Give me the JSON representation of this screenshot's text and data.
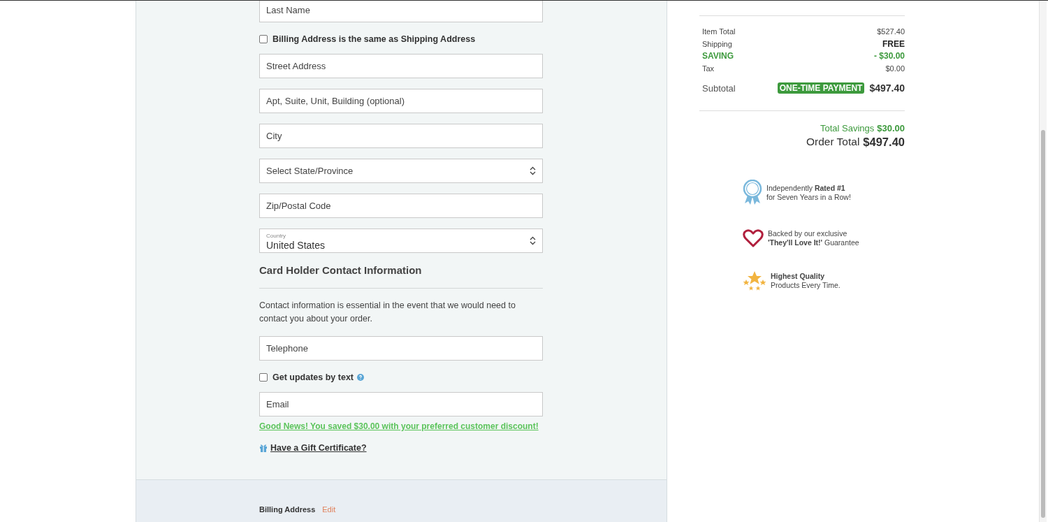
{
  "form": {
    "fields_top": [
      {
        "placeholder": "Last Name"
      }
    ],
    "same_address": {
      "label": "Billing Address is the same as Shipping Address",
      "checked": false
    },
    "address_fields": [
      {
        "kind": "text",
        "placeholder": "Street Address"
      },
      {
        "kind": "text",
        "placeholder": "Apt, Suite, Unit, Building (optional)"
      },
      {
        "kind": "text",
        "placeholder": "City"
      },
      {
        "kind": "select",
        "placeholder": "Select State/Province"
      },
      {
        "kind": "text",
        "placeholder": "Zip/Postal Code"
      },
      {
        "kind": "select",
        "label": "Country",
        "value": "United States"
      }
    ],
    "contact_heading": "Card Holder Contact Information",
    "contact_note": "Contact information is essential in the event that we would need to contact you about your order.",
    "telephone": {
      "placeholder": "Telephone"
    },
    "text_updates": {
      "label": "Get updates by text",
      "checked": false
    },
    "email": {
      "placeholder": "Email"
    },
    "discount_link": "Good News! You saved $30.00 with your preferred customer discount!",
    "gift_link": "Have a Gift Certificate?",
    "billing": {
      "label": "Billing Address",
      "edit": "Edit"
    }
  },
  "summary": {
    "lines": [
      {
        "kind": "plain",
        "label": "Item Total",
        "value": "$527.40"
      },
      {
        "kind": "bold",
        "label": "Shipping",
        "value": "FREE"
      },
      {
        "kind": "saving",
        "label": "SAVING",
        "value": "- $30.00"
      },
      {
        "kind": "plain",
        "label": "Tax",
        "value": "$0.00"
      }
    ],
    "subtotal": {
      "label": "Subtotal",
      "badge": "ONE-TIME PAYMENT",
      "value": "$497.40"
    },
    "total_savings": {
      "label": "Total Savings",
      "value": "$30.00"
    },
    "order_total": {
      "label": "Order Total",
      "value": "$497.40"
    }
  },
  "badges": [
    {
      "kind": "ribbon",
      "text": "Independently **Rated #1**\nfor Seven Years in a Row!"
    },
    {
      "kind": "heart",
      "text": "Backed by our exclusive\n**'They'll Love It!'** Guarantee"
    },
    {
      "kind": "stars",
      "text": "**Highest Quality**\nProducts Every Time."
    }
  ]
}
